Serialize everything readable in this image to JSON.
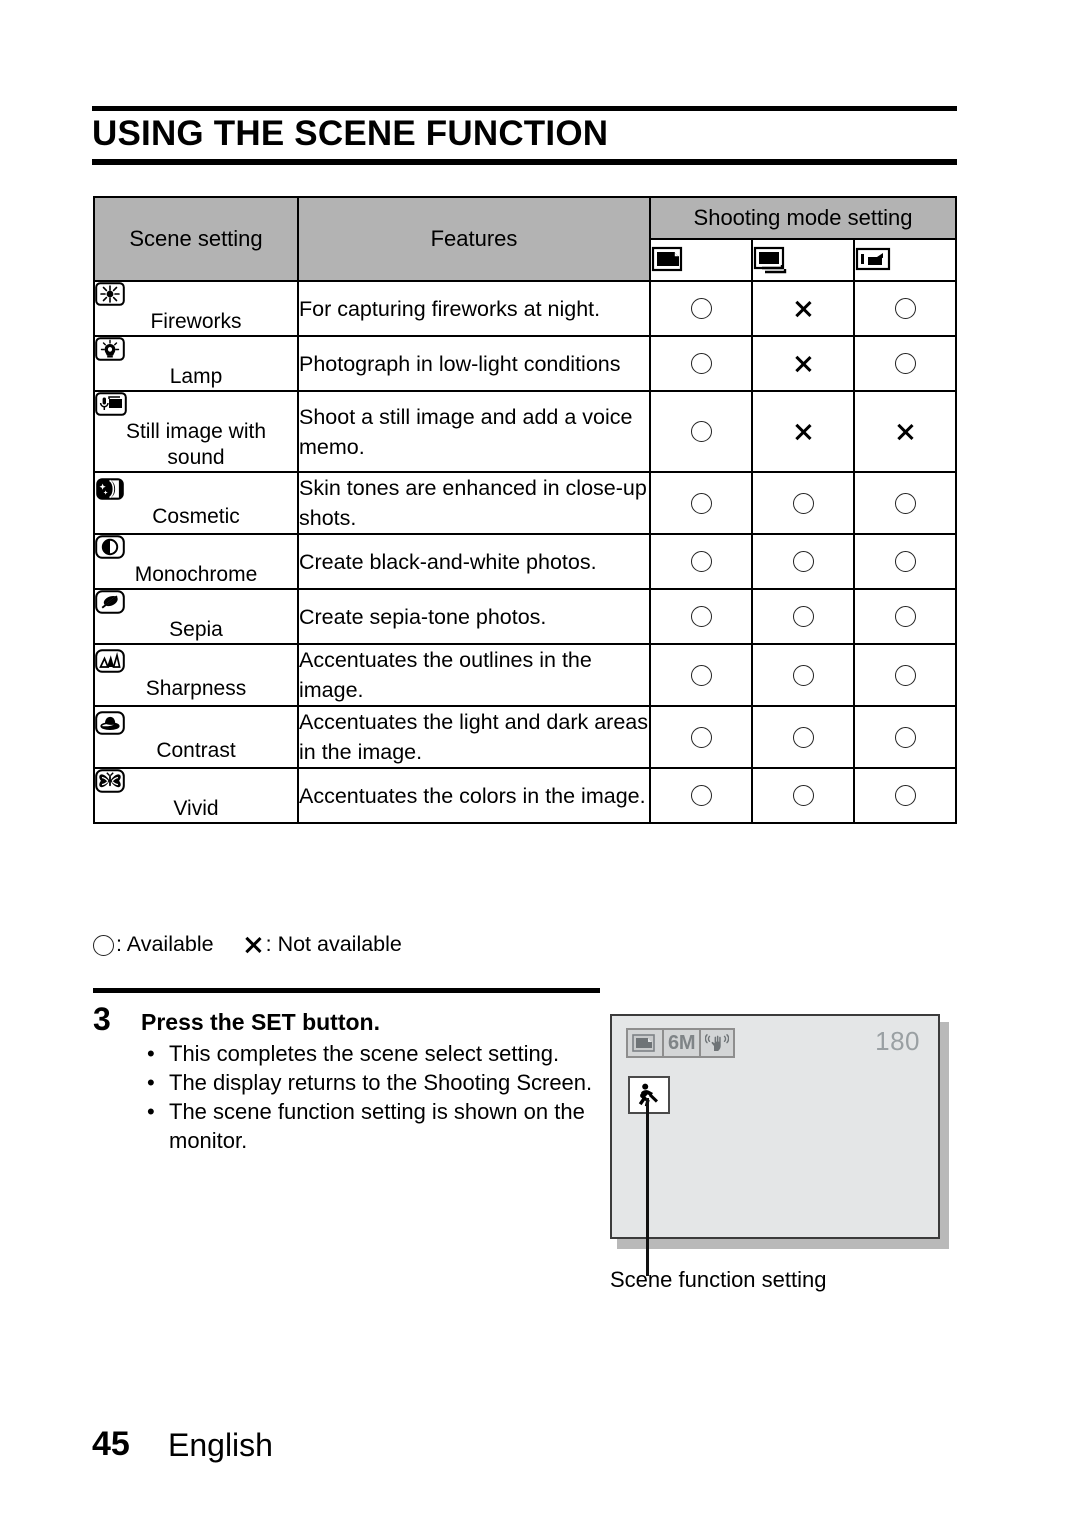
{
  "heading": {
    "title": "USING THE SCENE FUNCTION"
  },
  "table": {
    "headers": {
      "scene_setting": "Scene setting",
      "features": "Features",
      "shooting_mode_setting": "Shooting mode setting"
    },
    "mode_icons": [
      "single-shot-icon",
      "sequential-shot-icon",
      "video-clip-icon"
    ],
    "rows": [
      {
        "icon": "fireworks-icon",
        "label": "Fireworks",
        "feature": "For capturing fireworks at night.",
        "marks": [
          "circle",
          "cross",
          "circle"
        ]
      },
      {
        "icon": "lamp-icon",
        "label": "Lamp",
        "feature": "Photograph in low-light conditions",
        "marks": [
          "circle",
          "cross",
          "circle"
        ]
      },
      {
        "icon": "still-image-with-sound-icon",
        "label": "Still image with sound",
        "feature": "Shoot a still image and add a voice memo.",
        "marks": [
          "circle",
          "cross",
          "cross"
        ]
      },
      {
        "icon": "cosmetic-icon",
        "label": "Cosmetic",
        "feature": "Skin tones are enhanced in close-up shots.",
        "marks": [
          "circle",
          "circle",
          "circle"
        ]
      },
      {
        "icon": "monochrome-icon",
        "label": "Monochrome",
        "feature": "Create black-and-white photos.",
        "marks": [
          "circle",
          "circle",
          "circle"
        ]
      },
      {
        "icon": "sepia-icon",
        "label": "Sepia",
        "feature": "Create sepia-tone photos.",
        "marks": [
          "circle",
          "circle",
          "circle"
        ]
      },
      {
        "icon": "sharpness-icon",
        "label": "Sharpness",
        "feature": "Accentuates the outlines in the image.",
        "marks": [
          "circle",
          "circle",
          "circle"
        ]
      },
      {
        "icon": "contrast-icon",
        "label": "Contrast",
        "feature": "Accentuates the light and dark areas in the image.",
        "marks": [
          "circle",
          "circle",
          "circle"
        ]
      },
      {
        "icon": "vivid-icon",
        "label": "Vivid",
        "feature": "Accentuates the colors in the image.",
        "marks": [
          "circle",
          "circle",
          "circle"
        ]
      }
    ]
  },
  "legend": {
    "available": ": Available",
    "not_available": ": Not available"
  },
  "step": {
    "number": "3",
    "heading": "Press the SET button.",
    "bullets": [
      "This completes the scene select setting.",
      "The display returns to the Shooting Screen.",
      "The scene function setting is shown on the monitor."
    ],
    "bullet_marker": "•"
  },
  "monitor": {
    "osd": {
      "record_mode_icon": "single-shot-icon",
      "resolution": "6",
      "resolution_unit": "M",
      "stabilizer_icon": "image-stabilizer-icon"
    },
    "shots_remaining": "180",
    "scene_badge_icon": "sports-running-icon",
    "caption": "Scene function setting"
  },
  "footer": {
    "page_number": "45",
    "language": "English"
  },
  "colors": {
    "header_fill": "#b3b3b3",
    "monitor_fill": "#e4e6e7",
    "osd_grey": "#8e8e8e",
    "rule_black": "#000000"
  }
}
